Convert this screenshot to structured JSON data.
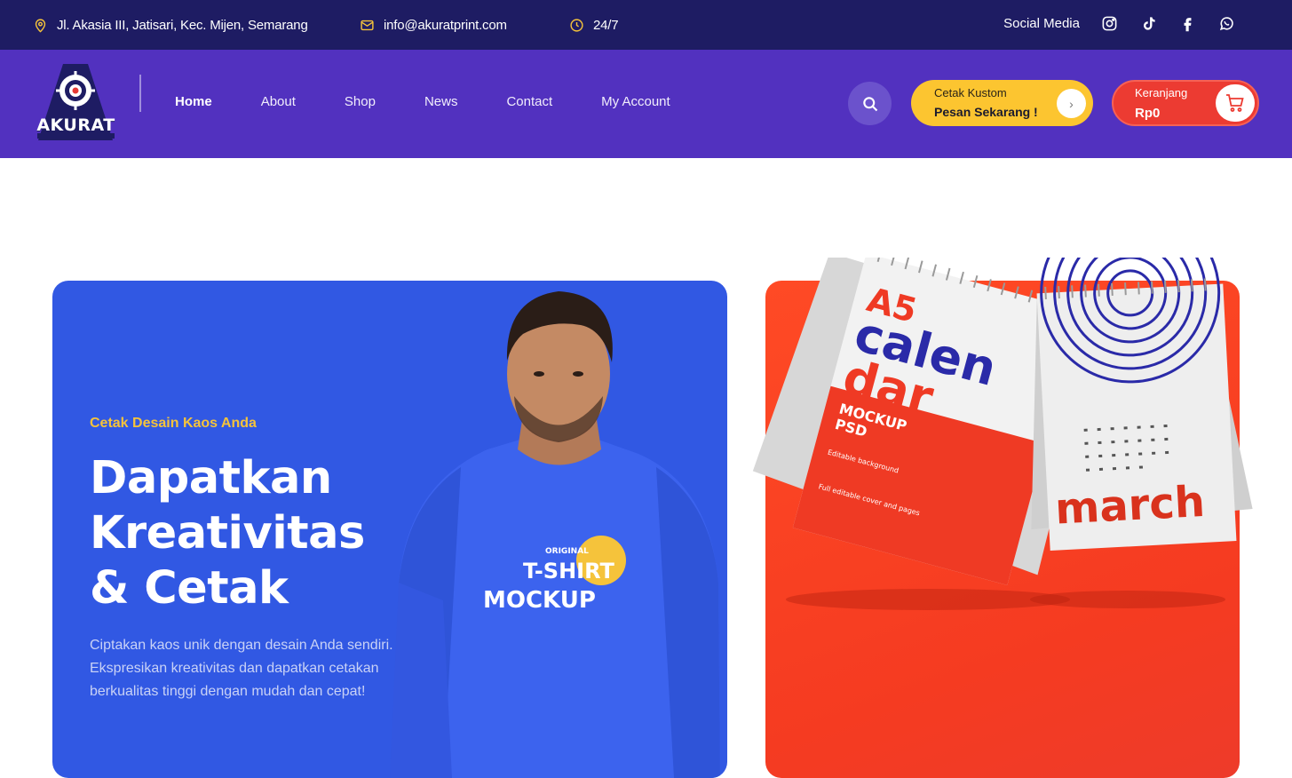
{
  "topbar": {
    "address": "Jl. Akasia III, Jatisari, Kec. Mijen, Semarang",
    "address_icon": "map-pin-icon",
    "email": "info@akuratprint.com",
    "email_icon": "mail-icon",
    "hours": "24/7",
    "hours_icon": "clock-icon",
    "social_label": "Social Media",
    "social_icons": [
      "instagram-icon",
      "tiktok-icon",
      "facebook-icon",
      "whatsapp-icon"
    ],
    "icon_color": "#f5c33b"
  },
  "header": {
    "logo_text": "AKURAT",
    "nav": [
      "Home",
      "About",
      "Shop",
      "News",
      "Contact",
      "My Account"
    ],
    "active_nav": "Home",
    "cta": {
      "line1": "Cetak Kustom",
      "line2": "Pesan Sekarang !",
      "arrow": "›"
    },
    "cart": {
      "label": "Keranjang",
      "amount": "Rp0"
    },
    "colors": {
      "bar": "#1e1c63",
      "header": "#5231bf",
      "cta": "#fcc530",
      "cart": "#ec3b32"
    }
  },
  "hero": {
    "eyebrow": "Cetak Desain Kaos Anda",
    "title": "Dapatkan Kreativitas & Cetak",
    "description": "Ciptakan kaos unik dengan desain Anda sendiri. Ekspresikan kreativitas dan dapatkan cetakan berkualitas tinggi dengan mudah dan cepat!",
    "shirt_text_top": "ORIGINAL",
    "shirt_text_mid": "T-SHIRT",
    "shirt_text_bottom": "MOCKUP",
    "colors": {
      "blue_card": "#3158e3",
      "red_card": "#f53b21",
      "accent": "#f5c33b"
    }
  },
  "promo": {
    "calendar_a5": "A5",
    "calendar_title_1": "calen",
    "calendar_title_2": "dar",
    "calendar_mockup": "MOCKUP",
    "calendar_psd": "PSD",
    "calendar_note_1": "Editable background",
    "calendar_note_2": "Full editable cover and pages",
    "calendar_month": "march"
  }
}
